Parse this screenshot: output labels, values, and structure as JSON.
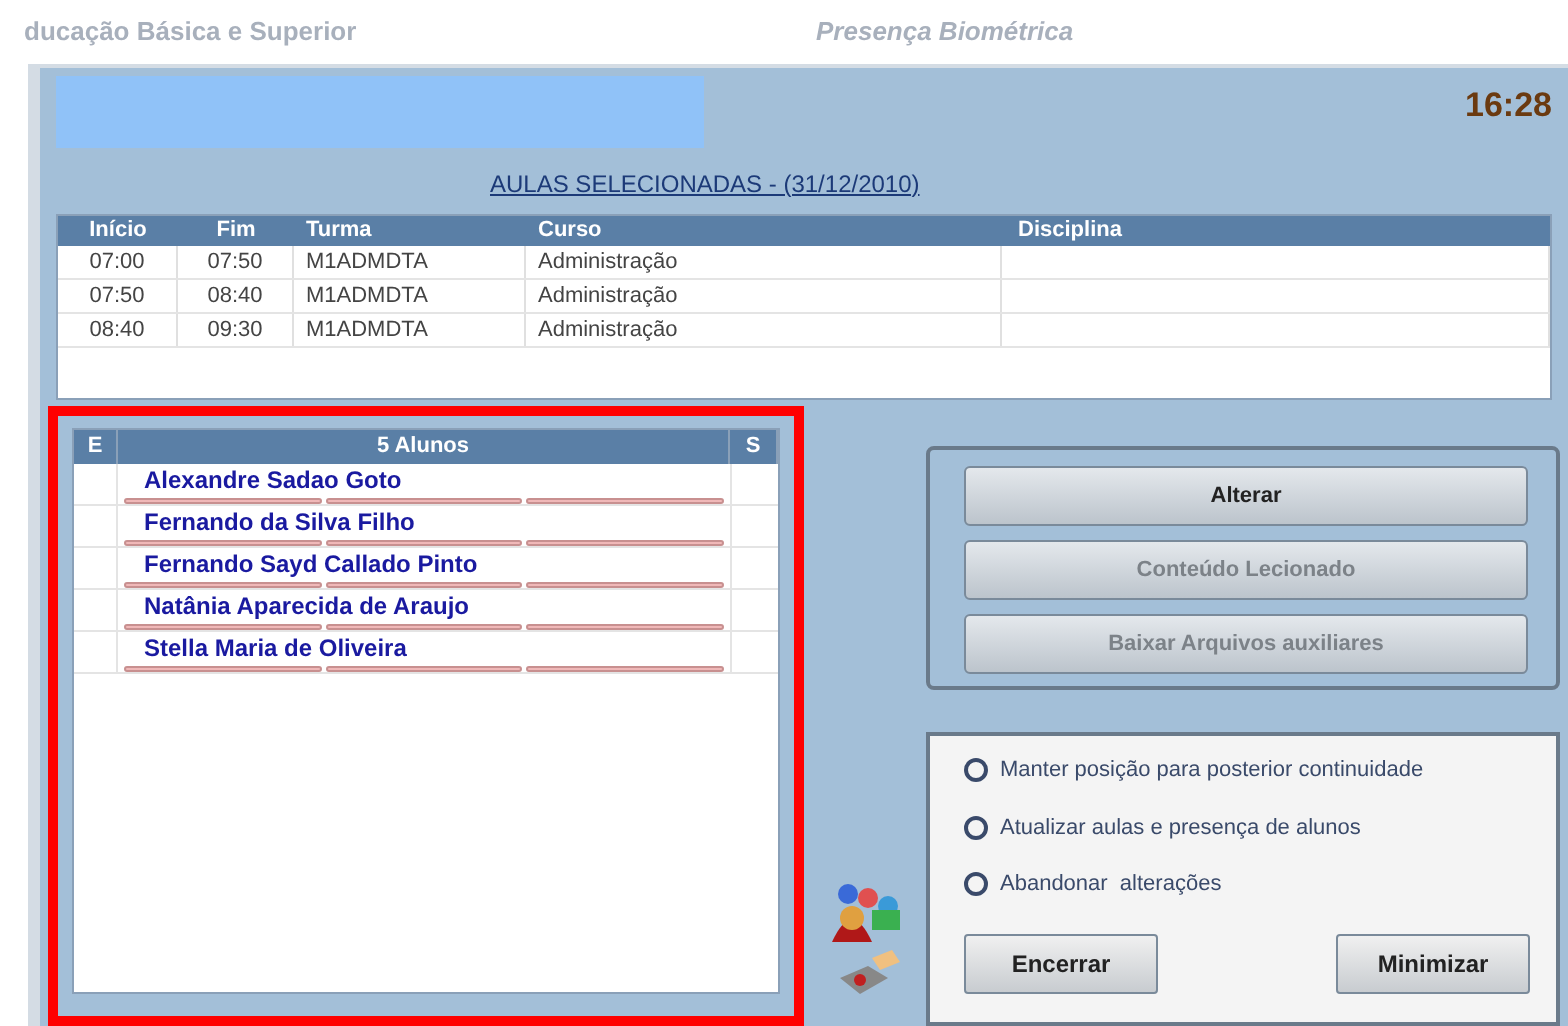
{
  "background_titles": [
    "ducação Básica e Superior",
    "Presença Biométrica"
  ],
  "clock": "16:28",
  "lessons": {
    "title": "AULAS SELECIONADAS - (31/12/2010)",
    "columns": [
      "Início",
      "Fim",
      "Turma",
      "Curso",
      "Disciplina"
    ],
    "rows": [
      [
        "07:00",
        "07:50",
        "M1ADMDTA",
        "Administração",
        ""
      ],
      [
        "07:50",
        "08:40",
        "M1ADMDTA",
        "Administração",
        ""
      ],
      [
        "08:40",
        "09:30",
        "M1ADMDTA",
        "Administração",
        ""
      ]
    ]
  },
  "students": {
    "columns": [
      "E",
      "5 Alunos",
      "S"
    ],
    "rows": [
      "Alexandre Sadao Goto",
      "Fernando da Silva Filho",
      "Fernando Sayd Callado Pinto",
      "Natânia Aparecida de Araujo",
      "Stella Maria de Oliveira"
    ]
  },
  "actions": [
    {
      "label": "Alterar",
      "disabled": false
    },
    {
      "label": "Conteúdo Lecionado",
      "disabled": true
    },
    {
      "label": "Baixar Arquivos auxiliares",
      "disabled": true
    }
  ],
  "options": [
    {
      "label": "Manter posição para posterior continuidade",
      "selected": false
    },
    {
      "label": "Atualizar aulas e presença de alunos",
      "selected": false
    },
    {
      "label": "Abandonar  alterações",
      "selected": false
    }
  ],
  "buttons": [
    "Encerrar",
    "Minimizar"
  ]
}
